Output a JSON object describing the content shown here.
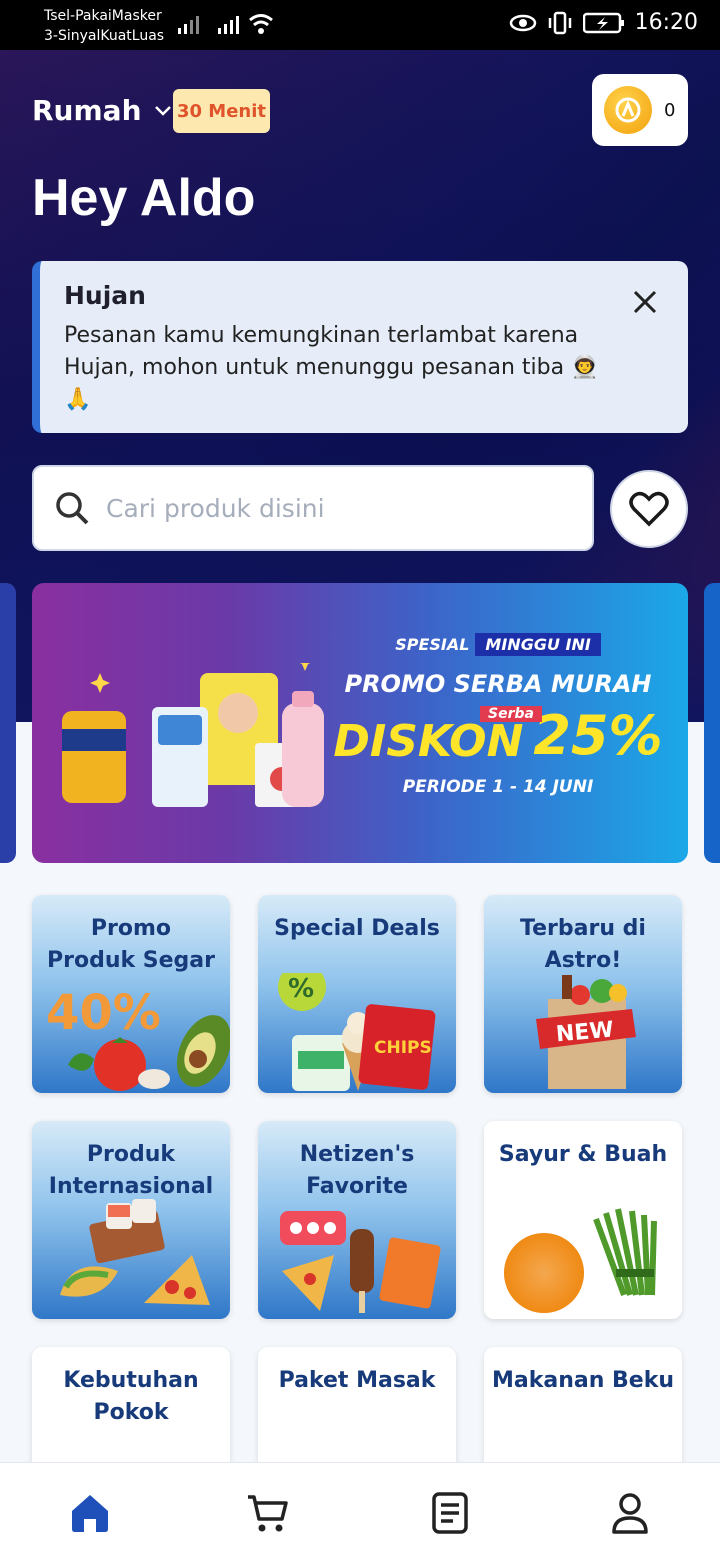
{
  "status_bar": {
    "carrier_1": "Tsel-PakaiMasker",
    "carrier_2": "3-SinyalKuatLuas",
    "time": "16:20"
  },
  "header": {
    "location": "Rumah",
    "eta_badge": "30 Menit",
    "coin_count": "0",
    "greeting": "Hey Aldo"
  },
  "alert": {
    "title": "Hujan",
    "body": "Pesanan kamu kemungkinan terlambat karena Hujan, mohon untuk menunggu pesanan tiba 👨‍🚀🙏"
  },
  "search": {
    "placeholder": "Cari produk disini"
  },
  "banner": {
    "line1a": "SPESIAL",
    "line1b": "MINGGU INI",
    "line2": "PROMO SERBA MURAH",
    "serba": "Serba",
    "diskon": "DISKON",
    "percent": "25%",
    "period": "PERIODE 1 - 14 JUNI"
  },
  "categories": [
    {
      "label": "Promo Produk Segar"
    },
    {
      "label": "Special Deals"
    },
    {
      "label": "Terbaru di Astro!"
    },
    {
      "label": "Produk Internasional"
    },
    {
      "label": "Netizen's Favorite"
    },
    {
      "label": "Sayur & Buah"
    },
    {
      "label": "Kebutuhan Pokok"
    },
    {
      "label": "Paket Masak"
    },
    {
      "label": "Makanan Beku"
    }
  ],
  "tile_art_text": {
    "promo_40": "40%",
    "new": "NEW",
    "chips": "CHIPS"
  },
  "colors": {
    "accent": "#1f4fb8",
    "badge_bg": "#fde9b0",
    "badge_text": "#e0542b",
    "alert_bg": "#e6edf8"
  },
  "nav": {
    "icons": [
      "home-icon",
      "cart-icon",
      "orders-icon",
      "profile-icon"
    ],
    "active": "home-icon"
  }
}
